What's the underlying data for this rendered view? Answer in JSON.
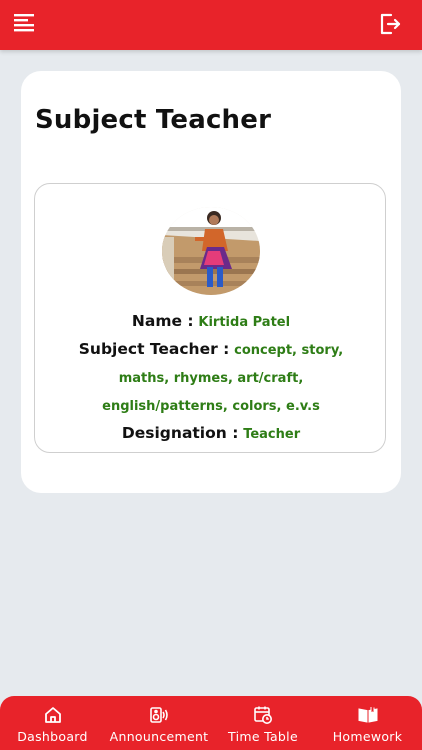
{
  "header": {
    "menu_icon": "menu-icon",
    "logout_icon": "logout-icon",
    "bar_color": "#e8232a"
  },
  "card": {
    "title": "Subject Teacher"
  },
  "teacher": {
    "avatar": "teacher-photo",
    "name_label": "Name :",
    "name_value": "Kirtida Patel",
    "subject_label": "Subject Teacher :",
    "subject_value": "concept, story, maths, rhymes, art/craft, english/patterns, colors, e.v.s",
    "designation_label": "Designation :",
    "designation_value": "Teacher",
    "value_color": "#2e7d16"
  },
  "bottom_nav": {
    "items": [
      {
        "label": "Dashboard",
        "icon": "home-icon"
      },
      {
        "label": "Announcement",
        "icon": "speaker-icon"
      },
      {
        "label": "Time Table",
        "icon": "calendar-clock-icon"
      },
      {
        "label": "Homework",
        "icon": "book-icon"
      }
    ]
  }
}
